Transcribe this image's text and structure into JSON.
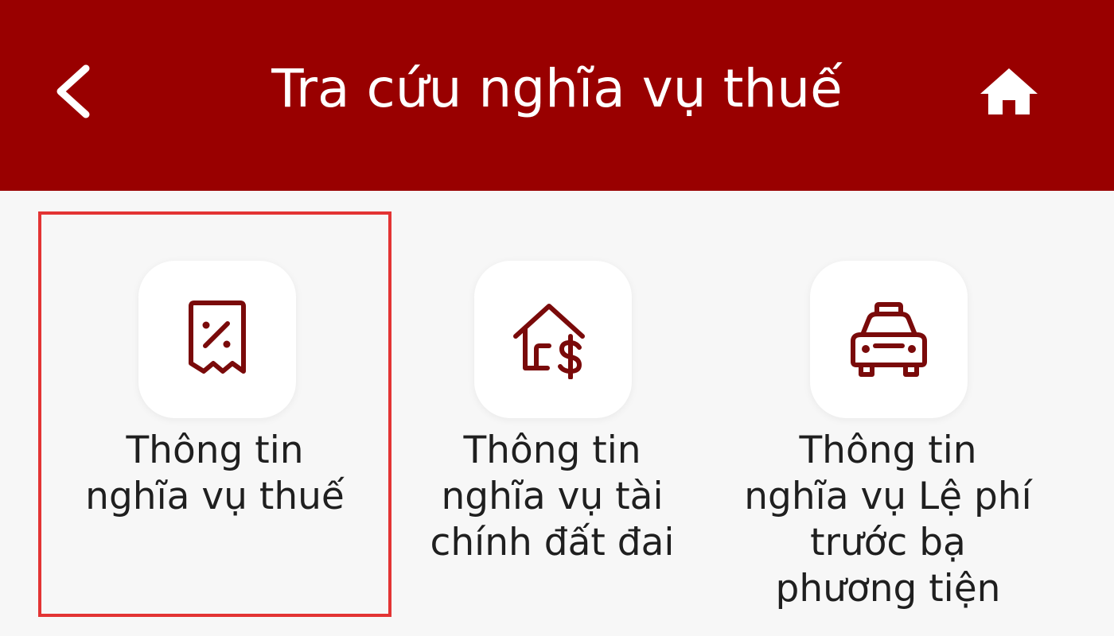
{
  "header": {
    "title": "Tra cứu nghĩa vụ thuế",
    "back_icon": "chevron-left-icon",
    "home_icon": "home-icon",
    "background_color": "#990000"
  },
  "tiles": [
    {
      "label": "Thông tin\nnghĩa vụ thuế",
      "icon": "tax-receipt-percent-icon",
      "selected": true
    },
    {
      "label": "Thông tin\nnghĩa vụ tài\nchính đất đai",
      "icon": "house-dollar-icon",
      "selected": false
    },
    {
      "label": "Thông tin\nnghĩa vụ Lệ phí\ntrước bạ\nphương tiện",
      "icon": "car-taxi-icon",
      "selected": false
    }
  ],
  "colors": {
    "accent": "#990000",
    "icon": "#7a0a0a",
    "selection_border": "#e33434"
  }
}
